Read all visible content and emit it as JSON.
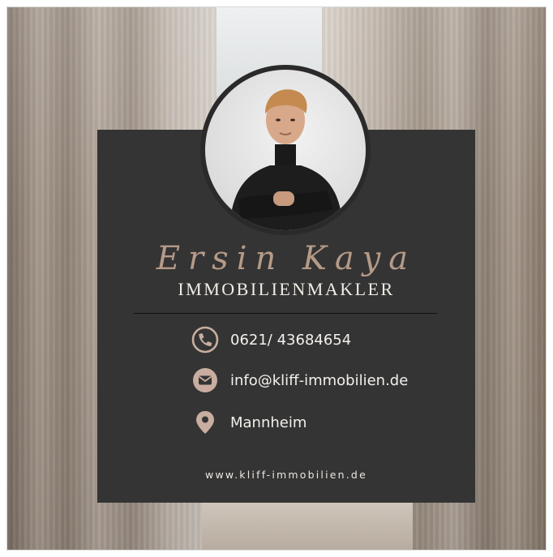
{
  "profile": {
    "name": "Ersin Kaya",
    "title": "IMMOBILIENMAKLER",
    "photo_icon": "person-portrait"
  },
  "contacts": [
    {
      "icon": "phone-icon",
      "text": "0621/ 43684654"
    },
    {
      "icon": "mail-icon",
      "text": "info@kliff-immobilien.de"
    },
    {
      "icon": "location-pin-icon",
      "text": "Mannheim"
    }
  ],
  "website": "www.kliff-immobilien.de",
  "colors": {
    "card": "#343434",
    "accent": "#c8ada0",
    "text": "#f3f0ec"
  }
}
